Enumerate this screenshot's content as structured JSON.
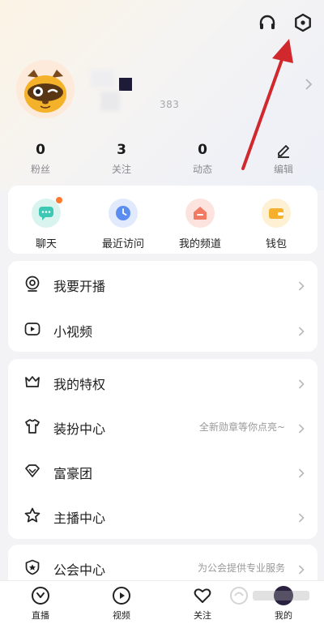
{
  "header": {
    "headset_icon": "headset-icon",
    "settings_icon": "settings-hexagon-icon"
  },
  "profile": {
    "uid_partial": "383"
  },
  "stats": [
    {
      "value": "0",
      "label": "粉丝"
    },
    {
      "value": "3",
      "label": "关注"
    },
    {
      "value": "0",
      "label": "动态"
    },
    {
      "label": "编辑"
    }
  ],
  "quick_actions": [
    {
      "label": "聊天",
      "color": "#3cc8b4"
    },
    {
      "label": "最近访问",
      "color": "#5b8cf0"
    },
    {
      "label": "我的频道",
      "color": "#f07a62"
    },
    {
      "label": "钱包",
      "color": "#f5b02e"
    }
  ],
  "menu_group_1": [
    {
      "label": "我要开播"
    },
    {
      "label": "小视频"
    }
  ],
  "menu_group_2": [
    {
      "label": "我的特权"
    },
    {
      "label": "装扮中心",
      "hint": "全新勋章等你点亮~"
    },
    {
      "label": "富豪团"
    },
    {
      "label": "主播中心"
    }
  ],
  "menu_group_3": [
    {
      "label": "公会中心",
      "hint": "为公会提供专业服务"
    }
  ],
  "tabbar": [
    {
      "label": "直播"
    },
    {
      "label": "视频"
    },
    {
      "label": "关注"
    },
    {
      "label": "我的"
    }
  ],
  "colors": {
    "annotation_arrow": "#d0282c",
    "accent_orange": "#ff7a2f"
  }
}
